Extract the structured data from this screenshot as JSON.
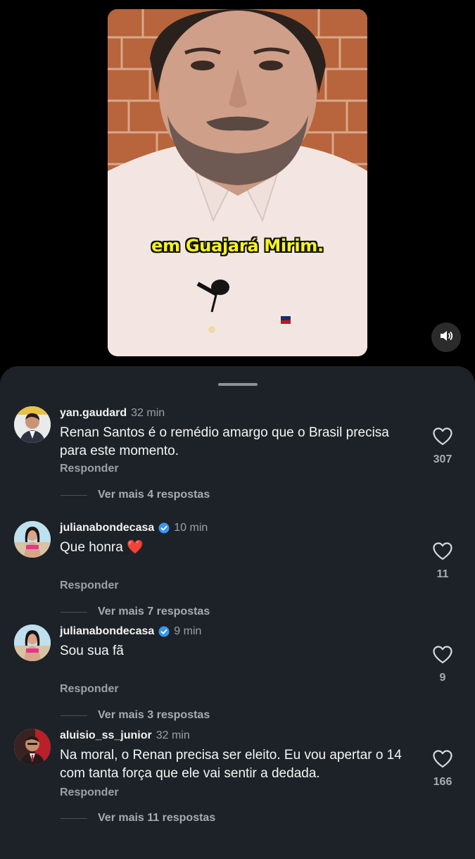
{
  "video": {
    "caption": "em Guajará Mirim."
  },
  "sound_button": {
    "icon": "speaker-icon"
  },
  "comments": [
    {
      "username": "yan.gaudard",
      "verified": false,
      "time": "32 min",
      "text": "Renan Santos é o remédio amargo que o Brasil precisa para este momento.",
      "reply_label": "Responder",
      "likes": "307",
      "more_replies": "Ver mais 4 respostas"
    },
    {
      "username": "julianabondecasa",
      "verified": true,
      "time": "10 min",
      "text": "Que honra",
      "emoji": "❤️",
      "reply_label": "Responder",
      "likes": "11",
      "more_replies": "Ver mais 7 respostas"
    },
    {
      "username": "julianabondecasa",
      "verified": true,
      "time": "9 min",
      "text": "Sou sua fã",
      "reply_label": "Responder",
      "likes": "9",
      "more_replies": "Ver mais 3 respostas"
    },
    {
      "username": "aluisio_ss_junior",
      "verified": false,
      "time": "32 min",
      "text": "Na moral, o Renan precisa ser eleito. Eu vou apertar o 14 com tanta força que ele vai sentir a dedada.",
      "reply_label": "Responder",
      "likes": "166",
      "more_replies": "Ver mais 11 respostas"
    }
  ],
  "colors": {
    "background": "#000000",
    "sheet": "#1c2227",
    "caption": "#f6f51e",
    "verified_badge": "#3897f0",
    "heart_emoji": "#e8232c"
  }
}
